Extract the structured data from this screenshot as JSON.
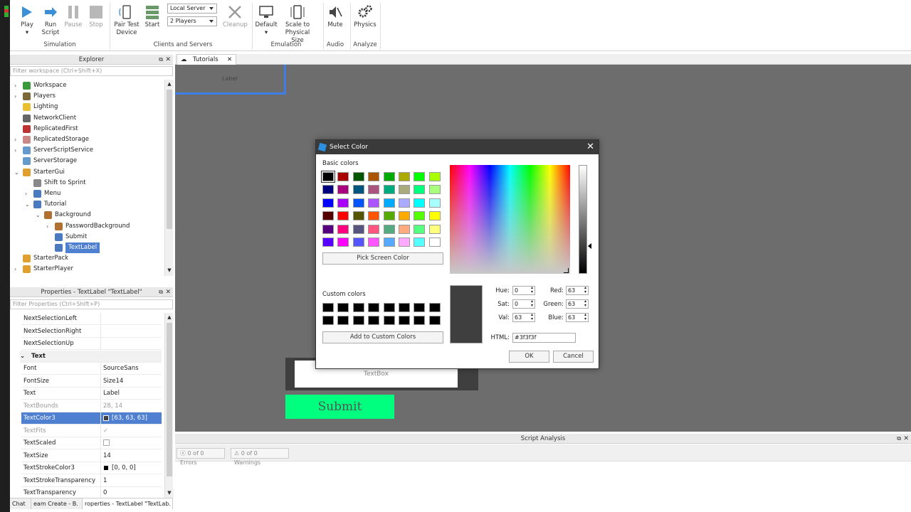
{
  "ribbon": {
    "buttons": {
      "play": "Play",
      "run_script": "Run Script",
      "pause": "Pause",
      "stop": "Stop",
      "pair_test_device": "Pair Test Device",
      "start": "Start",
      "cleanup": "Cleanup",
      "default": "Default",
      "scale_to_physical_size": "Scale to Physical Size",
      "mute": "Mute",
      "physics": "Physics"
    },
    "server_select": "Local Server",
    "players_select": "2 Players",
    "groups": {
      "simulation": "Simulation",
      "clients_and_servers": "Clients and Servers",
      "emulation": "Emulation",
      "audio": "Audio",
      "analyze": "Analyze"
    }
  },
  "explorer": {
    "title": "Explorer",
    "filter_placeholder": "Filter workspace (Ctrl+Shift+X)",
    "items": [
      {
        "label": "Workspace",
        "icon": "globe-icon"
      },
      {
        "label": "Players",
        "icon": "players-icon"
      },
      {
        "label": "Lighting",
        "icon": "bulb-icon"
      },
      {
        "label": "NetworkClient",
        "icon": "network-icon"
      },
      {
        "label": "ReplicatedFirst",
        "icon": "replicated-icon"
      },
      {
        "label": "ReplicatedStorage",
        "icon": "storage-icon"
      },
      {
        "label": "ServerScriptService",
        "icon": "gear-icon"
      },
      {
        "label": "ServerStorage",
        "icon": "storage-icon"
      },
      {
        "label": "StarterGui",
        "icon": "folder-icon"
      },
      {
        "label": "Shift to Sprint",
        "icon": "script-icon"
      },
      {
        "label": "Menu",
        "icon": "gui-icon"
      },
      {
        "label": "Tutorial",
        "icon": "gui-icon"
      },
      {
        "label": "Background",
        "icon": "frame-icon"
      },
      {
        "label": "PasswordBackground",
        "icon": "frame-icon"
      },
      {
        "label": "Submit",
        "icon": "button-icon"
      },
      {
        "label": "TextLabel",
        "icon": "textlabel-icon"
      },
      {
        "label": "StarterPack",
        "icon": "folder-icon"
      },
      {
        "label": "StarterPlayer",
        "icon": "folder-icon"
      }
    ]
  },
  "properties": {
    "title": "Properties - TextLabel \"TextLabel\"",
    "filter_placeholder": "Filter Properties (Ctrl+Shift+P)",
    "rows": [
      {
        "name": "NextSelectionLeft",
        "value": ""
      },
      {
        "name": "NextSelectionRight",
        "value": ""
      },
      {
        "name": "NextSelectionUp",
        "value": ""
      },
      {
        "name": "Text",
        "value": ""
      },
      {
        "name": "Font",
        "value": "SourceSans"
      },
      {
        "name": "FontSize",
        "value": "Size14"
      },
      {
        "name": "Text",
        "value": "Label"
      },
      {
        "name": "TextBounds",
        "value": "28, 14"
      },
      {
        "name": "TextColor3",
        "value": "[63, 63, 63]"
      },
      {
        "name": "TextFits",
        "value": "✓"
      },
      {
        "name": "TextScaled",
        "value": ""
      },
      {
        "name": "TextSize",
        "value": "14"
      },
      {
        "name": "TextStrokeColor3",
        "value": "[0, 0, 0]"
      },
      {
        "name": "TextStrokeTransparency",
        "value": "1"
      },
      {
        "name": "TextTransparency",
        "value": "0"
      }
    ]
  },
  "bottom_tabs": [
    "Chat",
    "eam Create - B.",
    "roperties - TextLabel \"TextLab."
  ],
  "document_tab": "Tutorials",
  "viewport": {
    "label_text": "Label",
    "textbox_text": "TextBox",
    "submit_text": "Submit",
    "submit_color": "#00ff7f",
    "frame_color": "#3f3f3f"
  },
  "script_analysis": {
    "title": "Script Analysis",
    "errors": "0 of 0 Errors",
    "warnings": "0 of 0 Warnings"
  },
  "dialog": {
    "title": "Select Color",
    "basic_colors_label": "Basic colors",
    "basic_colors": [
      "#000000",
      "#aa0000",
      "#005500",
      "#aa5500",
      "#00aa00",
      "#aaaa00",
      "#00ff00",
      "#aaff00",
      "#00007f",
      "#aa007f",
      "#00557f",
      "#aa557f",
      "#00aa7f",
      "#aaaa7f",
      "#00ff7f",
      "#aaff7f",
      "#0000ff",
      "#aa00ff",
      "#0055ff",
      "#aa55ff",
      "#00aaff",
      "#aaaaff",
      "#00ffff",
      "#aaffff",
      "#550000",
      "#ff0000",
      "#555500",
      "#ff5500",
      "#55aa00",
      "#ffaa00",
      "#55ff00",
      "#ffff00",
      "#55007f",
      "#ff007f",
      "#55557f",
      "#ff557f",
      "#55aa7f",
      "#ffaa7f",
      "#55ff7f",
      "#ffff7f",
      "#5500ff",
      "#ff00ff",
      "#5555ff",
      "#ff55ff",
      "#55aaff",
      "#ffaaff",
      "#55ffff",
      "#ffffff"
    ],
    "pick_screen_color": "Pick Screen Color",
    "custom_colors_label": "Custom colors",
    "add_custom": "Add to Custom Colors",
    "hue_label": "Hue:",
    "hue": "0",
    "sat_label": "Sat:",
    "sat": "0",
    "val_label": "Val:",
    "val": "63",
    "red_label": "Red:",
    "red": "63",
    "green_label": "Green:",
    "green": "63",
    "blue_label": "Blue:",
    "blue": "63",
    "html_label": "HTML:",
    "html": "#3f3f3f",
    "preview_color": "#3f3f3f",
    "ok": "OK",
    "cancel": "Cancel"
  }
}
